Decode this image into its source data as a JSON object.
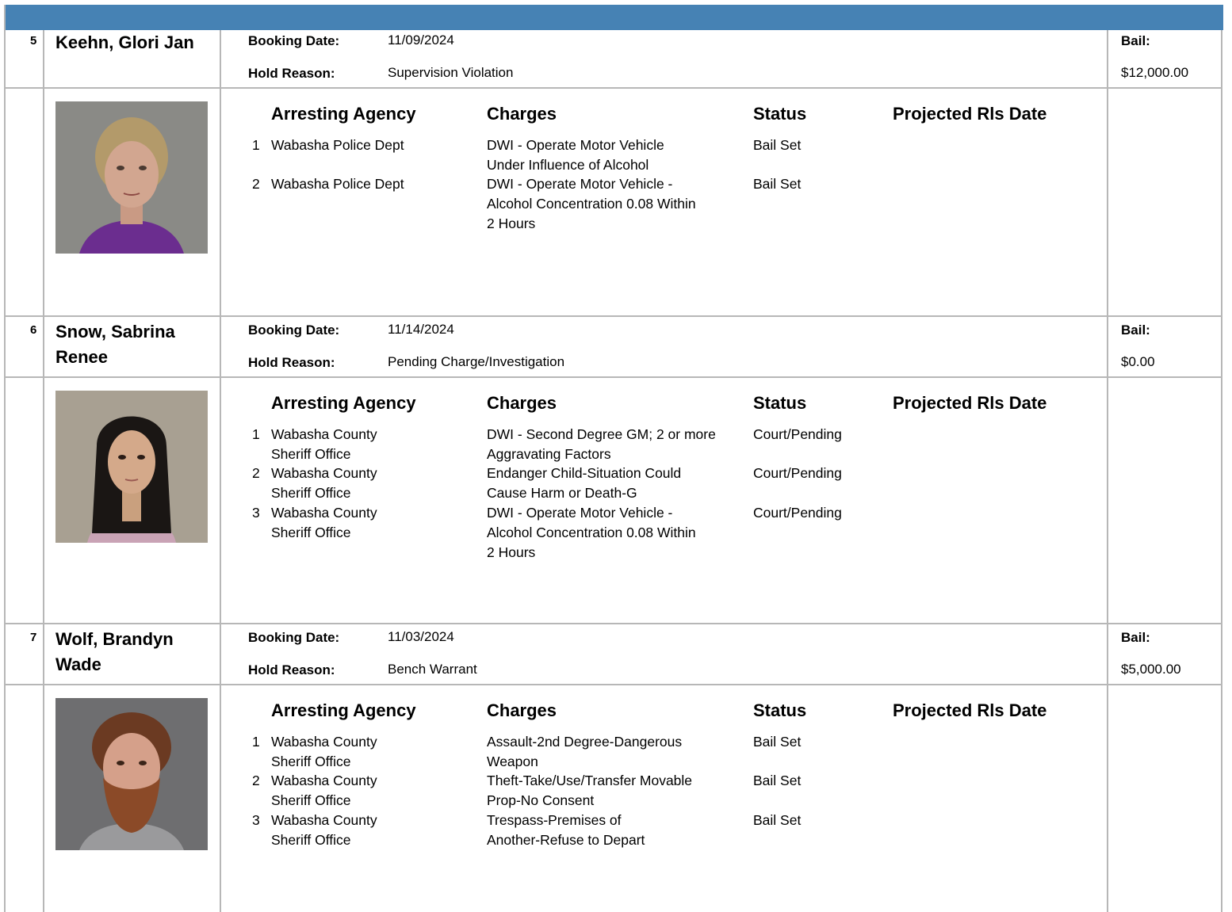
{
  "column_headers": {
    "agency": "Arresting Agency",
    "charges": "Charges",
    "status": "Status",
    "release": "Projected Rls Date"
  },
  "labels": {
    "booking_date": "Booking Date:",
    "hold_reason": "Hold Reason:",
    "bail": "Bail:"
  },
  "inmates": [
    {
      "number": "5",
      "name": "Keehn, Glori Jan",
      "booking_date": "11/09/2024",
      "hold_reason": "Supervision Violation",
      "bail": "$12,000.00",
      "charges": [
        {
          "num": "1",
          "agency": "Wabasha Police Dept",
          "charge": "DWI - Operate Motor Vehicle Under Influence of Alcohol",
          "status": "Bail Set"
        },
        {
          "num": "2",
          "agency": "Wabasha Police Dept",
          "charge": "DWI - Operate Motor Vehicle - Alcohol Concentration 0.08 Within 2 Hours",
          "status": "Bail Set"
        }
      ]
    },
    {
      "number": "6",
      "name": "Snow, Sabrina Renee",
      "booking_date": "11/14/2024",
      "hold_reason": "Pending Charge/Investigation",
      "bail": "$0.00",
      "charges": [
        {
          "num": "1",
          "agency": "Wabasha County Sheriff Office",
          "charge": "DWI - Second Degree GM; 2 or more Aggravating Factors",
          "status": "Court/Pending"
        },
        {
          "num": "2",
          "agency": "Wabasha County Sheriff Office",
          "charge": "Endanger Child-Situation Could Cause Harm or Death-G",
          "status": "Court/Pending"
        },
        {
          "num": "3",
          "agency": "Wabasha County Sheriff Office",
          "charge": "DWI - Operate Motor Vehicle - Alcohol Concentration 0.08 Within 2 Hours",
          "status": "Court/Pending"
        }
      ]
    },
    {
      "number": "7",
      "name": "Wolf, Brandyn Wade",
      "booking_date": "11/03/2024",
      "hold_reason": "Bench Warrant",
      "bail": "$5,000.00",
      "charges": [
        {
          "num": "1",
          "agency": "Wabasha County Sheriff Office",
          "charge": "Assault-2nd Degree-Dangerous Weapon",
          "status": "Bail Set"
        },
        {
          "num": "2",
          "agency": "Wabasha County Sheriff Office",
          "charge": "Theft-Take/Use/Transfer Movable Prop-No Consent",
          "status": "Bail Set"
        },
        {
          "num": "3",
          "agency": "Wabasha County Sheriff Office",
          "charge": "Trespass-Premises of Another-Refuse to Depart",
          "status": "Bail Set"
        }
      ]
    }
  ],
  "colors": {
    "header_bar": "#4682b4",
    "grid": "#b7b7b7"
  }
}
